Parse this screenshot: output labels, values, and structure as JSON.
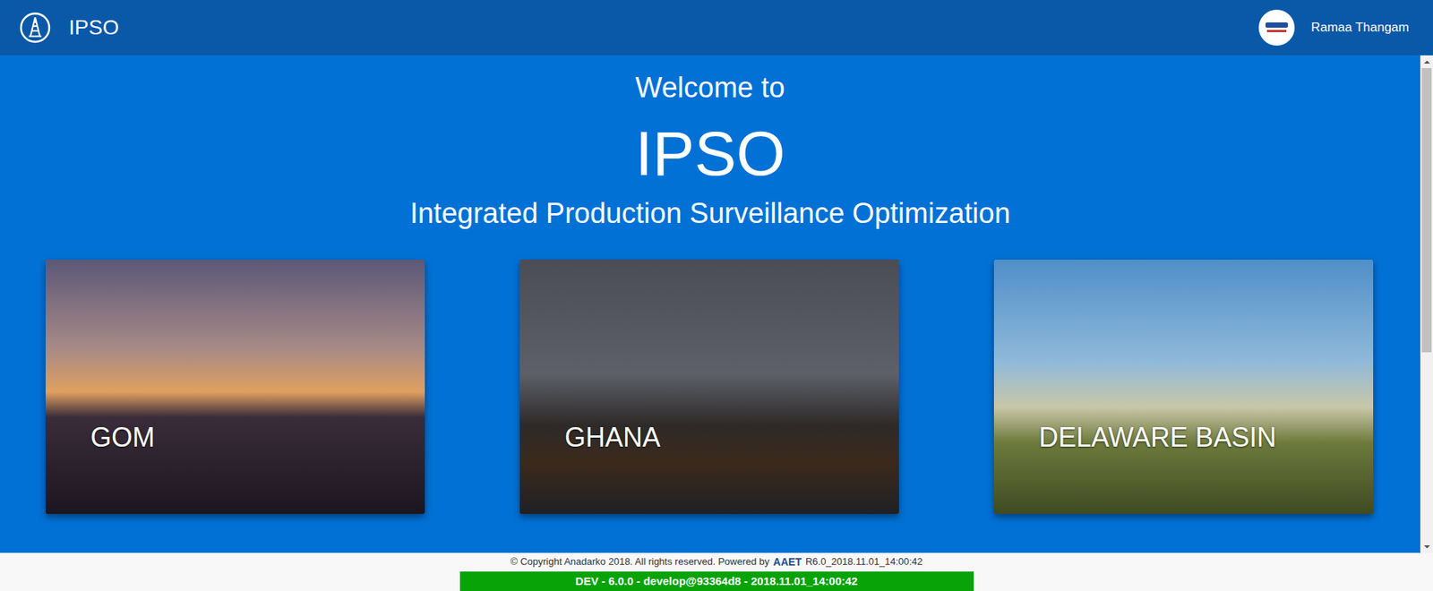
{
  "header": {
    "title": "IPSO",
    "user": "Ramaa Thangam"
  },
  "welcome": {
    "greeting": "Welcome to",
    "title": "IPSO",
    "subtitle": "Integrated Production Surveillance Optimization"
  },
  "regions": [
    {
      "label": "GOM"
    },
    {
      "label": "GHANA"
    },
    {
      "label": "DELAWARE BASIN"
    }
  ],
  "footer": {
    "copyright": "© Copyright Anadarko 2018. All rights reserved. Powered by",
    "powered_logo": "AAET",
    "version": "R6.0_2018.11.01_14:00:42"
  },
  "build_bar": {
    "text": "DEV - 6.0.0 - develop@93364d8 - 2018.11.01_14:00:42"
  }
}
